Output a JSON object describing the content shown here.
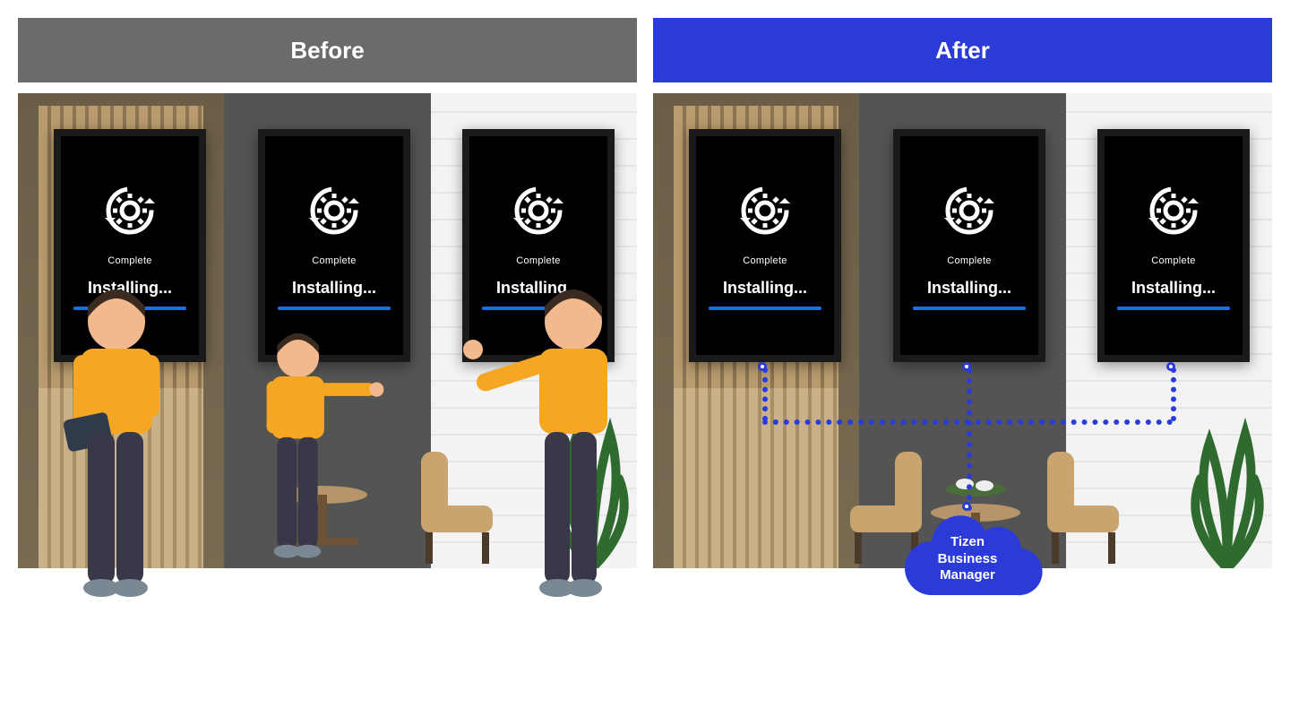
{
  "comparisonType": "before-after-infographic",
  "panels": {
    "before": {
      "header": "Before",
      "headerColor": "#6b6b6b",
      "method": "manual-per-device",
      "deviceCount": 3,
      "devices": [
        {
          "status": "Complete",
          "action": "Installing..."
        },
        {
          "status": "Complete",
          "action": "Installing..."
        },
        {
          "status": "Complete",
          "action": "Installing..."
        }
      ],
      "actors": [
        {
          "role": "technician",
          "pose": "holding-laptop"
        },
        {
          "role": "technician",
          "pose": "arm-extended"
        },
        {
          "role": "technician",
          "pose": "reaching-screen"
        }
      ]
    },
    "after": {
      "header": "After",
      "headerColor": "#2a3bd7",
      "method": "remote-via-cloud",
      "deviceCount": 3,
      "devices": [
        {
          "status": "Complete",
          "action": "Installing..."
        },
        {
          "status": "Complete",
          "action": "Installing..."
        },
        {
          "status": "Complete",
          "action": "Installing..."
        }
      ],
      "cloud": {
        "label": "Tizen\nBusiness\nManager",
        "line1": "Tizen",
        "line2": "Business",
        "line3": "Manager"
      }
    }
  },
  "icons": {
    "update": "gear-with-circular-arrows",
    "progressColor": "#1b6fe0"
  }
}
